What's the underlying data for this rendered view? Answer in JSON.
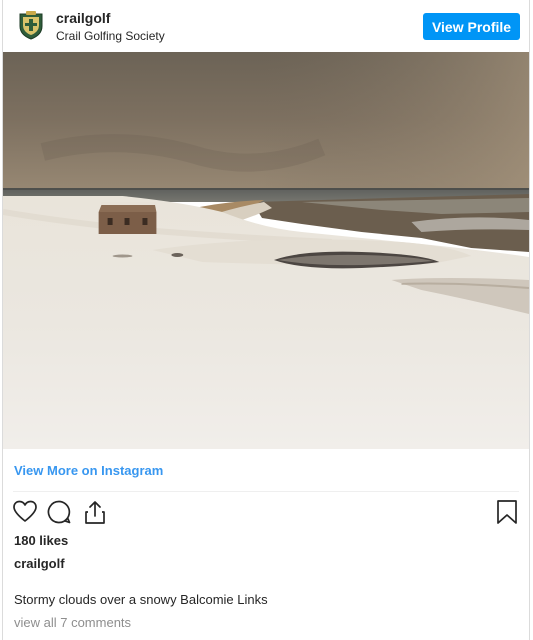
{
  "header": {
    "username": "crailgolf",
    "full_name": "Crail Golfing Society",
    "view_profile_label": "View Profile",
    "avatar_icon": "crail-golfing-society-crest"
  },
  "photo": {
    "subject": "snow-covered-golf-links-under-storm-clouds"
  },
  "view_more_label": "View More on Instagram",
  "actions": {
    "like_icon": "heart-icon",
    "comment_icon": "comment-icon",
    "share_icon": "share-icon",
    "save_icon": "bookmark-icon"
  },
  "likes_text": "180 likes",
  "caption": {
    "username": "crailgolf",
    "text": "Stormy clouds over a snowy Balcomie Links"
  },
  "comments_link": "view all 7 comments",
  "colors": {
    "accent": "#0095f6",
    "link": "#3897f0",
    "muted": "#8e8e8e",
    "text": "#262626"
  }
}
